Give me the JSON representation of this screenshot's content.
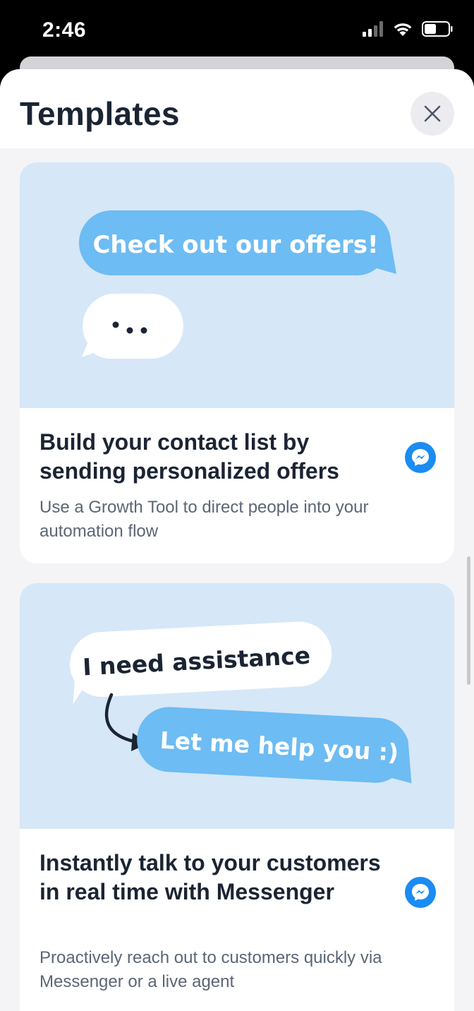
{
  "status_bar": {
    "time": "2:46",
    "icons": [
      "cellular-signal-icon",
      "wifi-icon",
      "battery-icon"
    ]
  },
  "sheet": {
    "title": "Templates",
    "close_icon": "close-icon"
  },
  "templates": [
    {
      "illustration": {
        "bubble_text": "Check out our offers!",
        "typing_indicator": "..."
      },
      "title": "Build your contact list by sending personalized offers",
      "description": "Use a Growth Tool to direct people into your automation flow",
      "channel_icon": "messenger-icon"
    },
    {
      "illustration": {
        "bubble_text_1": "I need assistance",
        "bubble_text_2": "Let me help you :)"
      },
      "title": "Instantly talk to your customers in real time with Messenger",
      "description": "Proactively reach out to customers quickly via Messenger or a live agent",
      "channel_icon": "messenger-icon"
    }
  ],
  "colors": {
    "illustration_bg": "#d6e7f7",
    "bubble_blue": "#6dbcf3",
    "messenger_blue": "#1a8cf2",
    "title_text": "#1b2433",
    "body_text": "#5b6676"
  }
}
